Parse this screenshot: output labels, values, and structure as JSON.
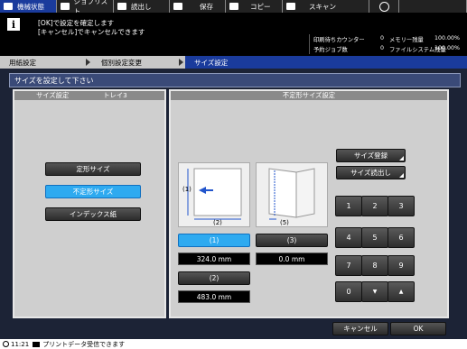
{
  "tabs": [
    {
      "label": "機械状態",
      "active": true
    },
    {
      "label": "ジョブリスト",
      "active": false
    },
    {
      "label": "読出し",
      "active": false
    },
    {
      "label": "保存",
      "active": false
    },
    {
      "label": "コピー",
      "active": false
    },
    {
      "label": "スキャン",
      "active": false
    },
    {
      "label": "",
      "active": false
    }
  ],
  "message": {
    "line1": "[OK]で設定を確定します",
    "line2": "[キャンセル]でキャンセルできます"
  },
  "counters": {
    "print_label": "印刷待ちカウンター",
    "print_value": "0",
    "job_label": "予約ジョブ数",
    "job_value": "0",
    "memory_label": "メモリー残量",
    "memory_value": "100.00%",
    "fs_label": "ファイルシステム残量",
    "fs_value": "100.00%"
  },
  "breadcrumb": [
    "用紙設定",
    "個別設定変更",
    "サイズ設定"
  ],
  "instruction": "サイズを設定して下さい",
  "left_panel": {
    "title": "サイズ設定",
    "tray": "トレイ3",
    "buttons": [
      "定形サイズ",
      "不定形サイズ",
      "インデックス紙"
    ],
    "selected": "不定形サイズ"
  },
  "right_panel": {
    "title": "不定形サイズ設定",
    "register_label": "サイズ登録",
    "recall_label": "サイズ読出し",
    "diagram1": {
      "label1": "(1)",
      "label2": "(2)"
    },
    "diagram2": {
      "label5": "(5)"
    },
    "fields": [
      {
        "label": "(1)",
        "value": "324.0  mm",
        "selected": true
      },
      {
        "label": "(3)",
        "value": "0.0  mm",
        "selected": false
      },
      {
        "label": "(2)",
        "value": "483.0  mm",
        "selected": false
      }
    ],
    "keypad": [
      "1",
      "2",
      "3",
      "4",
      "5",
      "6",
      "7",
      "8",
      "9",
      "0",
      "▼",
      "▲"
    ]
  },
  "footer": {
    "cancel": "キャンセル",
    "ok": "OK"
  },
  "status": {
    "time": "11:21",
    "text": "プリントデータ受信できます"
  }
}
